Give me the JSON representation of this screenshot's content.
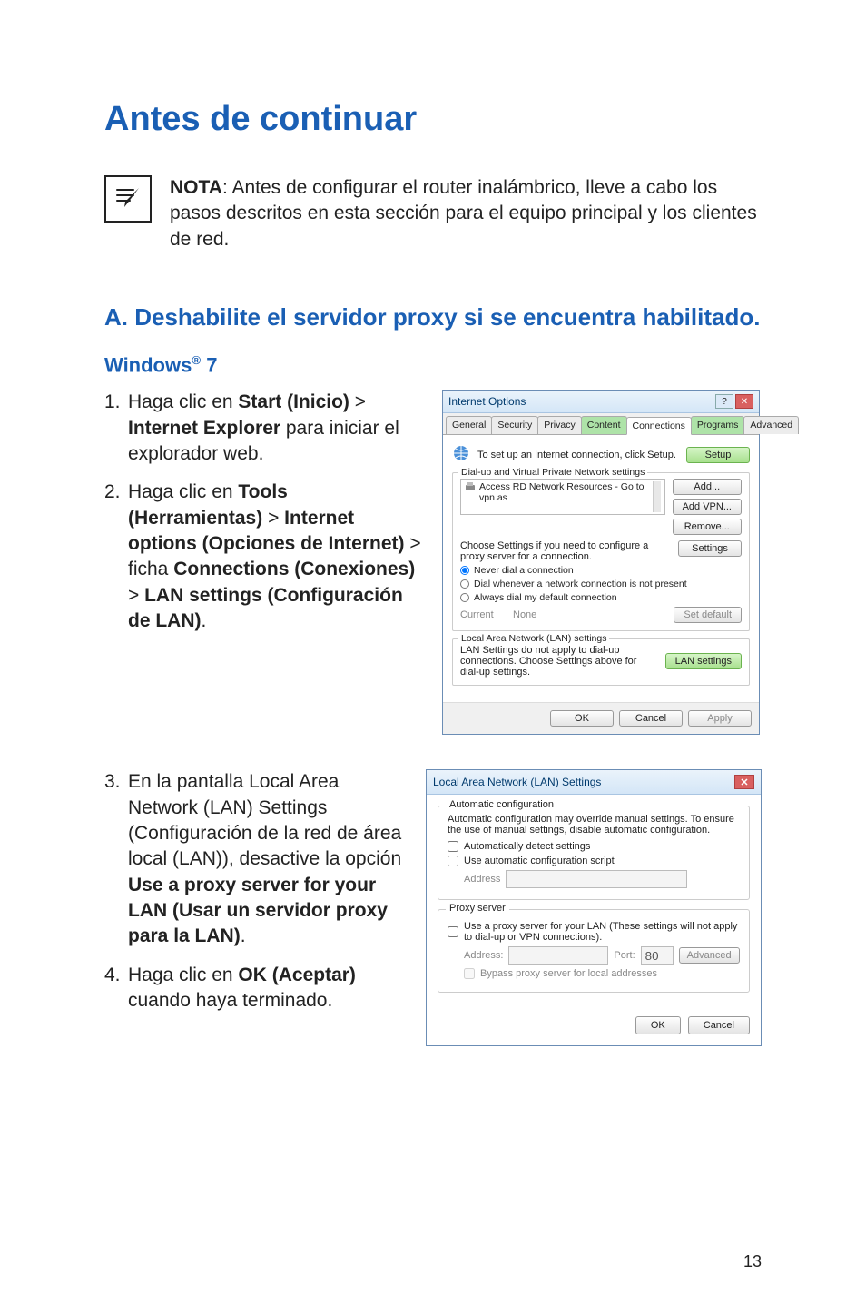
{
  "page": {
    "title": "Antes de continuar",
    "note_label": "NOTA",
    "note_body": ":    Antes de configurar el router inalámbrico, lleve a cabo los pasos descritos en esta sección para el equipo principal y los clientes de red.",
    "section_a": "A.    Deshabilite el servidor proxy si se encuentra habilitado.",
    "win7": "Windows® 7",
    "page_number": "13"
  },
  "steps_a": [
    {
      "num": "1.",
      "pre": "Haga clic en ",
      "b1": "Start (Inicio)",
      "mid1": " > ",
      "b2": "Internet Explorer",
      "post": " para iniciar el explorador web."
    },
    {
      "num": "2.",
      "pre": "Haga clic en ",
      "b1": "Tools (Herramientas)",
      "mid1": " > ",
      "b2": "Internet options (Opciones de Internet)",
      "mid2": " > ficha ",
      "b3": "Connections (Conexiones)",
      "mid3": " > ",
      "b4": "LAN settings (Configuración de LAN)",
      "post": "."
    }
  ],
  "steps_b": [
    {
      "num": "3.",
      "pre": "En la pantalla Local Area Network (LAN) Settings (Configuración de la red de área local (LAN)), desactive la opción ",
      "b1": "Use a proxy server for your LAN (Usar un servidor proxy para la LAN)",
      "post": "."
    },
    {
      "num": "4.",
      "pre": "Haga clic en ",
      "b1": "OK (Aceptar)",
      "post": " cuando haya terminado."
    }
  ],
  "io": {
    "title": "Internet Options",
    "tabs": [
      "General",
      "Security",
      "Privacy",
      "Content",
      "Connections",
      "Programs",
      "Advanced"
    ],
    "setup_text": "To set up an Internet connection, click Setup.",
    "setup_btn": "Setup",
    "dvpn_label": "Dial-up and Virtual Private Network settings",
    "list_item": "Access RD Network Resources - Go to vpn.as",
    "add_btn": "Add...",
    "addvpn_btn": "Add VPN...",
    "remove_btn": "Remove...",
    "choose_text": "Choose Settings if you need to configure a proxy server for a connection.",
    "settings_btn": "Settings",
    "r_never": "Never dial a connection",
    "r_whenever": "Dial whenever a network connection is not present",
    "r_always": "Always dial my default connection",
    "current_l": "Current",
    "current_v": "None",
    "setdef_btn": "Set default",
    "lan_label": "Local Area Network (LAN) settings",
    "lan_text": "LAN Settings do not apply to dial-up connections. Choose Settings above for dial-up settings.",
    "lan_btn": "LAN settings",
    "ok": "OK",
    "cancel": "Cancel",
    "apply": "Apply"
  },
  "lan": {
    "title": "Local Area Network (LAN) Settings",
    "auto_legend": "Automatic configuration",
    "auto_desc": "Automatic configuration may override manual settings. To ensure the use of manual settings, disable automatic configuration.",
    "auto_detect": "Automatically detect settings",
    "auto_script": "Use automatic configuration script",
    "address_lbl": "Address",
    "proxy_legend": "Proxy server",
    "proxy_use": "Use a proxy server for your LAN (These settings will not apply to dial-up or VPN connections).",
    "address2_lbl": "Address:",
    "port_lbl": "Port:",
    "port_val": "80",
    "adv_btn": "Advanced",
    "bypass": "Bypass proxy server for local addresses",
    "ok": "OK",
    "cancel": "Cancel"
  },
  "chart_data": null
}
